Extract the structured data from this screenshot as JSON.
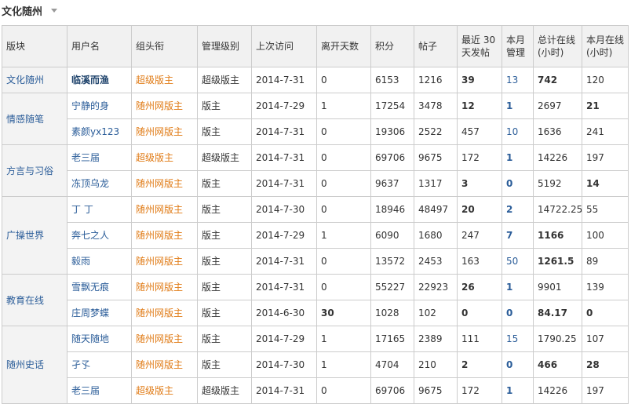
{
  "header": {
    "title": "文化随州"
  },
  "columns": [
    "版块",
    "用户名",
    "组头衔",
    "管理级别",
    "上次访问",
    "离开天数",
    "积分",
    "帖子",
    "最近 30 天发帖",
    "本月管理",
    "总计在线(小时)",
    "本月在线(小时)"
  ],
  "groups": [
    {
      "block": "文化随州",
      "rows": [
        {
          "user": "临溪而渔",
          "user_bold": true,
          "title": "超级版主",
          "level": "超级版主",
          "last": "2014-7-31",
          "away": "0",
          "away_bold": false,
          "points": "6153",
          "posts": "1216",
          "recent": "39",
          "recent_bold": true,
          "manage": "13",
          "manage_bold": false,
          "total": "742",
          "total_bold": true,
          "month": "120",
          "month_bold": false
        }
      ]
    },
    {
      "block": "情感随笔",
      "rows": [
        {
          "user": "宁静的身",
          "user_bold": false,
          "title": "随州网版主",
          "level": "版主",
          "last": "2014-7-29",
          "away": "1",
          "away_bold": false,
          "points": "17254",
          "posts": "3478",
          "recent": "12",
          "recent_bold": true,
          "manage": "1",
          "manage_bold": true,
          "total": "2697",
          "total_bold": false,
          "month": "21",
          "month_bold": true
        },
        {
          "user": "素颜yx123",
          "user_bold": false,
          "title": "随州网版主",
          "level": "版主",
          "last": "2014-7-31",
          "away": "0",
          "away_bold": false,
          "points": "19306",
          "posts": "2522",
          "recent": "457",
          "recent_bold": false,
          "manage": "10",
          "manage_bold": false,
          "total": "1636",
          "total_bold": false,
          "month": "241",
          "month_bold": false
        }
      ]
    },
    {
      "block": "方言与习俗",
      "rows": [
        {
          "user": "老三届",
          "user_bold": false,
          "title": "超级版主",
          "level": "超级版主",
          "last": "2014-7-31",
          "away": "0",
          "away_bold": false,
          "points": "69706",
          "posts": "9675",
          "recent": "172",
          "recent_bold": false,
          "manage": "1",
          "manage_bold": true,
          "total": "14226",
          "total_bold": false,
          "month": "197",
          "month_bold": false
        },
        {
          "user": "冻顶乌龙",
          "user_bold": false,
          "title": "随州网版主",
          "level": "版主",
          "last": "2014-7-31",
          "away": "0",
          "away_bold": false,
          "points": "9637",
          "posts": "1317",
          "recent": "3",
          "recent_bold": true,
          "manage": "0",
          "manage_bold": true,
          "total": "5192",
          "total_bold": false,
          "month": "14",
          "month_bold": true
        }
      ]
    },
    {
      "block": "广操世界",
      "rows": [
        {
          "user": "丁 丁",
          "user_bold": false,
          "title": "随州网版主",
          "level": "版主",
          "last": "2014-7-30",
          "away": "0",
          "away_bold": false,
          "points": "18946",
          "posts": "48497",
          "recent": "20",
          "recent_bold": true,
          "manage": "2",
          "manage_bold": true,
          "total": "14722.25",
          "total_bold": false,
          "month": "55",
          "month_bold": false
        },
        {
          "user": "奔七之人",
          "user_bold": false,
          "title": "随州网版主",
          "level": "版主",
          "last": "2014-7-29",
          "away": "1",
          "away_bold": false,
          "points": "6090",
          "posts": "1680",
          "recent": "247",
          "recent_bold": false,
          "manage": "7",
          "manage_bold": true,
          "total": "1166",
          "total_bold": true,
          "month": "100",
          "month_bold": false
        },
        {
          "user": "毅雨",
          "user_bold": false,
          "title": "随州网版主",
          "level": "版主",
          "last": "2014-7-31",
          "away": "0",
          "away_bold": false,
          "points": "13572",
          "posts": "2453",
          "recent": "163",
          "recent_bold": false,
          "manage": "50",
          "manage_bold": false,
          "total": "1261.5",
          "total_bold": true,
          "month": "89",
          "month_bold": false
        }
      ]
    },
    {
      "block": "教育在线",
      "rows": [
        {
          "user": "雪飘无痕",
          "user_bold": false,
          "title": "随州网版主",
          "level": "版主",
          "last": "2014-7-31",
          "away": "0",
          "away_bold": false,
          "points": "55227",
          "posts": "22923",
          "recent": "26",
          "recent_bold": true,
          "manage": "1",
          "manage_bold": true,
          "total": "9901",
          "total_bold": false,
          "month": "139",
          "month_bold": false
        },
        {
          "user": "庄周梦蝶",
          "user_bold": false,
          "title": "随州网版主",
          "level": "版主",
          "last": "2014-6-30",
          "away": "30",
          "away_bold": true,
          "points": "1028",
          "posts": "102",
          "recent": "0",
          "recent_bold": true,
          "manage": "0",
          "manage_bold": true,
          "total": "84.17",
          "total_bold": true,
          "month": "0",
          "month_bold": true
        }
      ]
    },
    {
      "block": "随州史话",
      "rows": [
        {
          "user": "随天随地",
          "user_bold": false,
          "title": "随州网版主",
          "level": "版主",
          "last": "2014-7-29",
          "away": "1",
          "away_bold": false,
          "points": "17165",
          "posts": "2389",
          "recent": "111",
          "recent_bold": false,
          "manage": "15",
          "manage_bold": false,
          "total": "1790.25",
          "total_bold": false,
          "month": "107",
          "month_bold": false
        },
        {
          "user": "孑孓",
          "user_bold": false,
          "title": "随州网版主",
          "level": "版主",
          "last": "2014-7-30",
          "away": "1",
          "away_bold": false,
          "points": "4704",
          "posts": "210",
          "recent": "2",
          "recent_bold": true,
          "manage": "0",
          "manage_bold": true,
          "total": "466",
          "total_bold": true,
          "month": "28",
          "month_bold": true
        },
        {
          "user": "老三届",
          "user_bold": false,
          "title": "超级版主",
          "level": "超级版主",
          "last": "2014-7-31",
          "away": "0",
          "away_bold": false,
          "points": "69706",
          "posts": "9675",
          "recent": "172",
          "recent_bold": false,
          "manage": "1",
          "manage_bold": true,
          "total": "14226",
          "total_bold": false,
          "month": "197",
          "month_bold": false
        }
      ]
    }
  ]
}
